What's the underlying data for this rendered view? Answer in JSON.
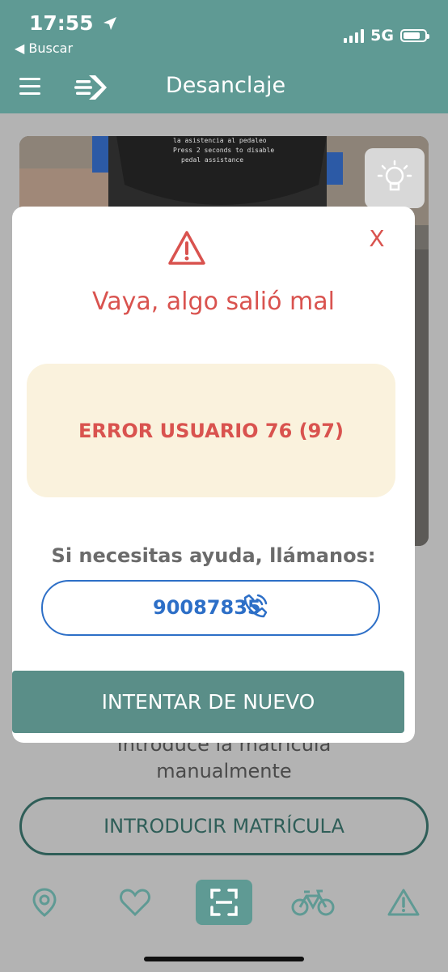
{
  "status_bar": {
    "time": "17:55",
    "back_app": "◀ Buscar",
    "network": "5G"
  },
  "navbar": {
    "title": "Desanclaje"
  },
  "scanner": {
    "photo_text": [
      "la asistencia al pedaleo",
      "Press 2 seconds to disable",
      "pedal assistance"
    ],
    "manual_prompt_line1": "Introduce la matrícula",
    "manual_prompt_line2": "manualmente",
    "manual_button_label": "INTRODUCIR MATRÍCULA"
  },
  "tabs": [
    {
      "icon": "map-pin-icon",
      "active": false
    },
    {
      "icon": "heart-icon",
      "active": false
    },
    {
      "icon": "scan-icon",
      "active": true
    },
    {
      "icon": "bicycle-icon",
      "active": false
    },
    {
      "icon": "warning-icon",
      "active": false
    }
  ],
  "modal": {
    "close_label": "X",
    "title": "Vaya, algo salió mal",
    "error_message": "ERROR USUARIO 76 (97)",
    "help_text": "Si necesitas ayuda, llámanos:",
    "phone_number": "90087835",
    "retry_label": "INTENTAR DE NUEVO"
  },
  "colors": {
    "brand": "#5f9a94",
    "error": "#d9534f",
    "link": "#2d6fc7",
    "error_box": "#faf2dd"
  }
}
